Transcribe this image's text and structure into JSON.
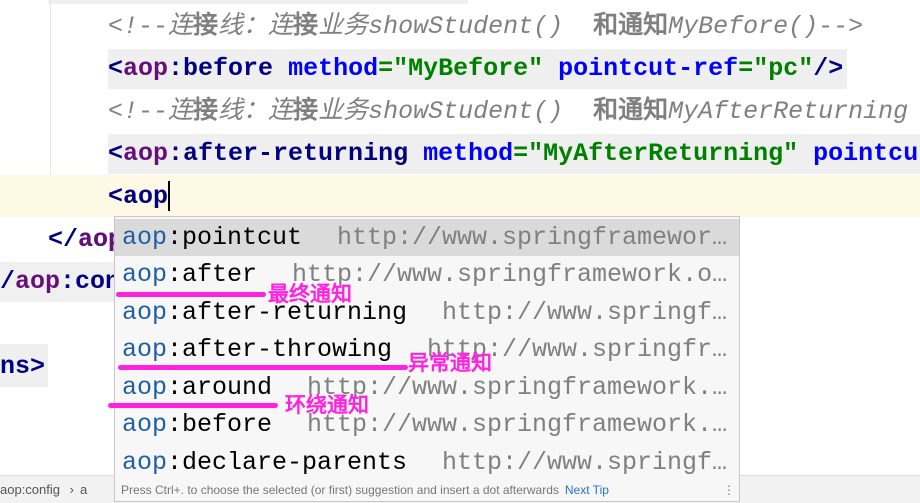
{
  "editor": {
    "lines": [
      {
        "comment_pre": "<!--连",
        "comment_b1": "接",
        "comment_mid": "线：连",
        "comment_b2": "接",
        "comment_post": "业务showStudent()  ",
        "comment_b3": "和通知",
        "comment_end": "MyBefore()-->"
      },
      {
        "open": "<",
        "ns": "aop",
        "tag": ":before",
        "a1": " method",
        "eq1": "=",
        "v1": "\"MyBefore\"",
        "a2": " pointcut-ref",
        "eq2": "=",
        "v2": "\"pc\"",
        "close": "/>"
      },
      {
        "comment_pre": "<!--连",
        "comment_b1": "接",
        "comment_mid": "线：连",
        "comment_b2": "接",
        "comment_post": "业务showStudent()  ",
        "comment_b3": "和通知",
        "comment_end": "MyAfterReturning"
      },
      {
        "open": "<",
        "ns": "aop",
        "tag": ":after-returning",
        "a1": " method",
        "eq1": "=",
        "v1": "\"MyAfterReturning\"",
        "a2": " pointcut",
        "eq2": "",
        "v2": "",
        "close": ""
      },
      {
        "open": "<",
        "ns": "aop"
      }
    ],
    "left_fragments": {
      "close_aop": "</aop",
      "close_aop_ns": "aop",
      "close_config_pre": "/",
      "close_config_ns": "aop",
      "close_config_tag": ":con",
      "beans": "ns>"
    }
  },
  "popup": {
    "items": [
      {
        "ns": "aop",
        "name": ":pointcut",
        "url": "http://www.springframewor…",
        "selected": true
      },
      {
        "ns": "aop",
        "name": ":after",
        "url": "http://www.springframework.o…"
      },
      {
        "ns": "aop",
        "name": ":after-returning",
        "url": "http://www.springf…"
      },
      {
        "ns": "aop",
        "name": ":after-throwing",
        "url": "http://www.springfr…"
      },
      {
        "ns": "aop",
        "name": ":around",
        "url": "http://www.springframework.…"
      },
      {
        "ns": "aop",
        "name": ":before",
        "url": "http://www.springframework.…"
      },
      {
        "ns": "aop",
        "name": ":declare-parents",
        "url": "http://www.springf…"
      }
    ],
    "footer": {
      "hint": "Press Ctrl+. to choose the selected (or first) suggestion and insert a dot afterwards",
      "next_tip": "Next Tip",
      "menu": "⋮"
    }
  },
  "annotations": {
    "after": "最终通知",
    "after_throwing": "异常通知",
    "around": "环绕通知",
    "color": "#ff22e0"
  },
  "statusbar": {
    "breadcrumb1": "aop:config",
    "sep": "›",
    "breadcrumb2": "a"
  }
}
